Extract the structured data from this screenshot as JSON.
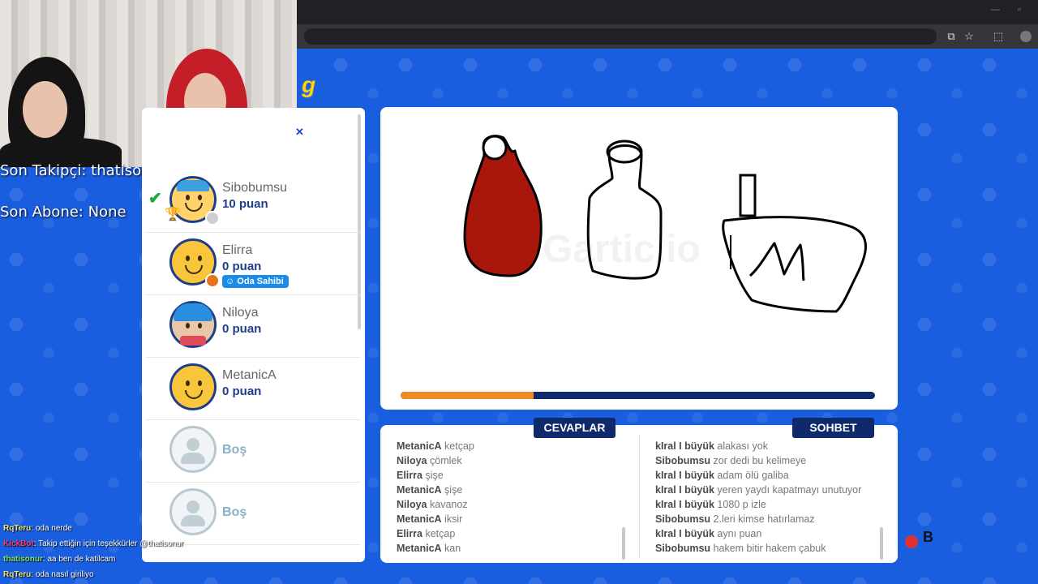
{
  "overlay": {
    "last_follower": "Son Takipçi: thatisonur",
    "last_sub": "Son Abone: None"
  },
  "players": [
    {
      "name": "Sibobumsu",
      "score": "10 puan",
      "avatar": "avatar-cap-boy",
      "status": "gray",
      "guessed": true,
      "trophy": "2"
    },
    {
      "name": "Elirra",
      "score": "0 puan",
      "avatar": "avatar-smiley",
      "status": "orange",
      "badge": "Oda Sahibi"
    },
    {
      "name": "Niloya",
      "score": "0 puan",
      "avatar": "avatar-blue-hair-girl"
    },
    {
      "name": "MetanicA",
      "score": "0 puan",
      "avatar": "avatar-smiley"
    },
    {
      "name": "Boş"
    },
    {
      "name": "Boş"
    }
  ],
  "canvas": {
    "watermark": "Gartic.io",
    "progress": 0.28,
    "colors": {
      "ketchup": "#a8160c",
      "progress_fill": "#f08a24",
      "progress_track": "#0f2a6b"
    }
  },
  "tabs": {
    "answers": "CEVAPLAR",
    "chat": "SOHBET"
  },
  "answers": [
    {
      "user": "MetanicA",
      "text": "ketçap"
    },
    {
      "user": "Niloya",
      "text": "çömlek"
    },
    {
      "user": "Elirra",
      "text": "şişe"
    },
    {
      "user": "MetanicA",
      "text": "şişe"
    },
    {
      "user": "Niloya",
      "text": "kavanoz"
    },
    {
      "user": "MetanicA",
      "text": "iksir"
    },
    {
      "user": "Elirra",
      "text": "ketçap"
    },
    {
      "user": "MetanicA",
      "text": "kan"
    }
  ],
  "chat": [
    {
      "user": "kIral I büyük",
      "text": "alakası yok"
    },
    {
      "user": "Sibobumsu",
      "text": "zor dedi bu kelimeye"
    },
    {
      "user": "kIral I büyük",
      "text": "adam ölü galiba"
    },
    {
      "user": "kIral I büyük",
      "text": "yeren yaydı kapatmayı unutuyor"
    },
    {
      "user": "kIral I büyük",
      "text": "1080 p izle"
    },
    {
      "user": "Sibobumsu",
      "text": "2.leri kimse hatırlamaz"
    },
    {
      "user": "kIral I büyük",
      "text": "aynı puan"
    },
    {
      "user": "Sibobumsu",
      "text": "hakem bitir hakem çabuk"
    }
  ],
  "stream_chat": [
    {
      "user": "RqTeru",
      "text": ": oda nerde"
    },
    {
      "user": "KickBot",
      "text": ": Takip ettiğin için teşekkürler @thatisonur"
    },
    {
      "user": "thatisonur",
      "text": ": aa ben de katilcam"
    },
    {
      "user": "RqTeru",
      "text": ": oda nasıl giriliyo"
    }
  ]
}
